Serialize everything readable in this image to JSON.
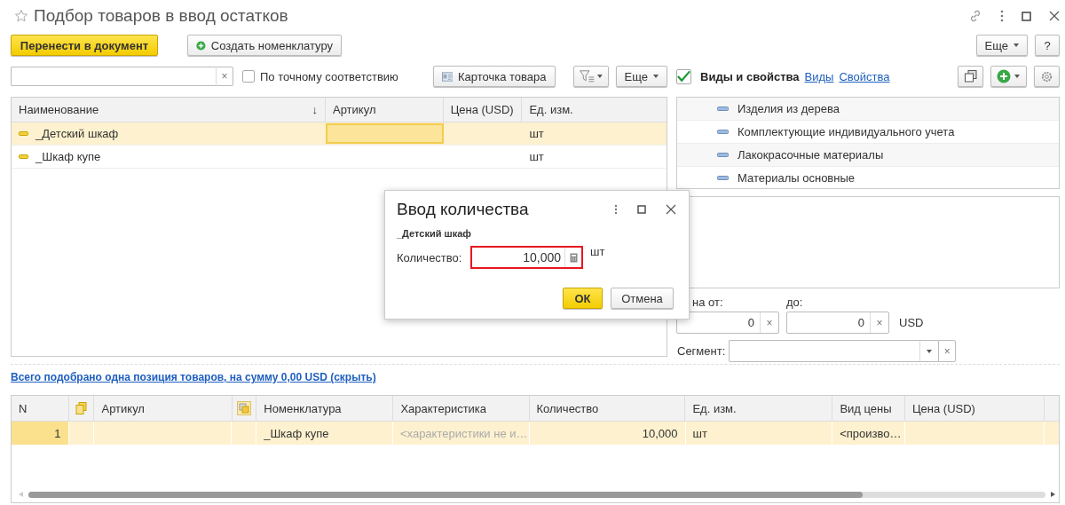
{
  "window": {
    "title": "Подбор товаров в ввод остатков",
    "favorite": false
  },
  "toolbar": {
    "primary": "Перенести в документ",
    "create": "Создать номенклатуру",
    "more": "Еще",
    "help": "?"
  },
  "search": {
    "clear": "×"
  },
  "exact_match": {
    "label": "По точному соответствию",
    "checked": false
  },
  "product_card": "Карточка товара",
  "list_more": "Еще",
  "products": {
    "columns": [
      "Наименование",
      "Артикул",
      "Цена (USD)",
      "Ед. изм."
    ],
    "sort_mark": "↓",
    "rows": [
      {
        "name": "_Детский шкаф",
        "unit": "шт",
        "selected": true
      },
      {
        "name": "_Шкаф купе",
        "unit": "шт",
        "selected": false
      }
    ]
  },
  "properties": {
    "checked": true,
    "title": "Виды и свойства",
    "links": [
      "Виды",
      "Свойства"
    ],
    "items": [
      {
        "label": "Изделия из дерева"
      },
      {
        "label": "Комплектующие индивидуального учета"
      },
      {
        "label": "Лакокрасочные материалы"
      },
      {
        "label": "Материалы основные"
      }
    ]
  },
  "price_filter": {
    "from_label": "на от:",
    "from_value": "0",
    "to_label": "до:",
    "to_value": "0",
    "clear": "×",
    "currency": "USD"
  },
  "segment": {
    "label": "Сегмент:",
    "clear": "×"
  },
  "summary_link": "Всего подобрано одна позиция товаров, на сумму 0,00 USD (скрыть)",
  "picked": {
    "columns": [
      {
        "kind": "text",
        "label": "N"
      },
      {
        "kind": "icon"
      },
      {
        "kind": "text",
        "label": "Артикул"
      },
      {
        "kind": "icon"
      },
      {
        "kind": "text",
        "label": "Номенклатура"
      },
      {
        "kind": "text",
        "label": "Характеристика"
      },
      {
        "kind": "text",
        "label": "Количество"
      },
      {
        "kind": "text",
        "label": "Ед. изм."
      },
      {
        "kind": "text",
        "label": "Вид цены"
      },
      {
        "kind": "text",
        "label": "Цена (USD)"
      }
    ],
    "rows": [
      {
        "cells": [
          "1",
          null,
          null,
          null,
          "_Шкаф купе",
          "<характеристики не и…",
          "10,000",
          "шт",
          "<произво…",
          null
        ],
        "selected": true
      }
    ]
  },
  "dialog": {
    "title": "Ввод количества",
    "item": "_Детский шкаф",
    "quantity_label": "Количество:",
    "quantity": "10,000",
    "invalid": true,
    "unit": "шт",
    "ok": "ОК",
    "cancel": "Отмена"
  }
}
